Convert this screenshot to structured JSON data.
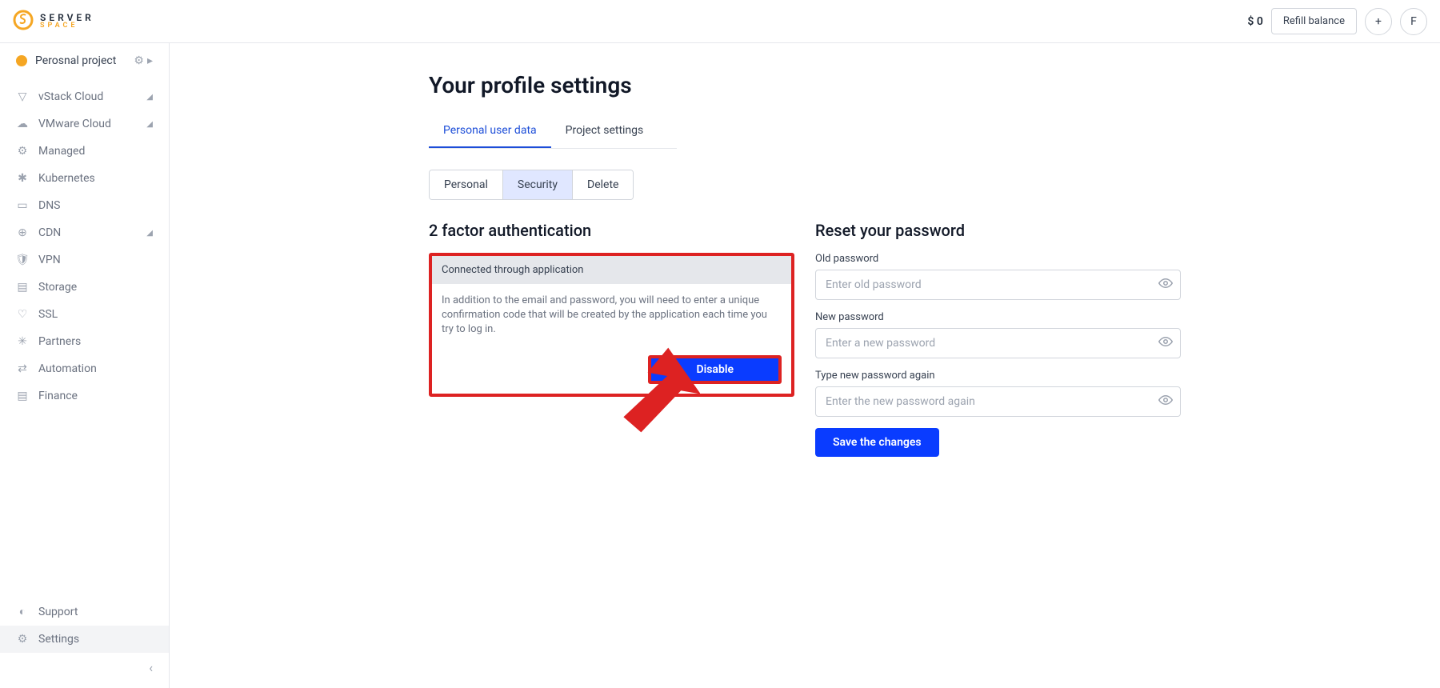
{
  "header": {
    "brand_top": "SERVER",
    "brand_sub": "SPACE",
    "balance": "$ 0",
    "refill_label": "Refill balance",
    "plus_label": "+",
    "avatar_letter": "F"
  },
  "sidebar": {
    "project_name": "Perosnal project",
    "items": [
      {
        "label": "vStack Cloud",
        "icon": "▽",
        "expandable": true
      },
      {
        "label": "VMware Cloud",
        "icon": "☁",
        "expandable": true
      },
      {
        "label": "Managed",
        "icon": "⚙",
        "expandable": false
      },
      {
        "label": "Kubernetes",
        "icon": "✱",
        "expandable": false
      },
      {
        "label": "DNS",
        "icon": "▭",
        "expandable": false
      },
      {
        "label": "CDN",
        "icon": "⊕",
        "expandable": true
      },
      {
        "label": "VPN",
        "icon": "🛡",
        "expandable": false
      },
      {
        "label": "Storage",
        "icon": "▤",
        "expandable": false
      },
      {
        "label": "SSL",
        "icon": "♡",
        "expandable": false
      },
      {
        "label": "Partners",
        "icon": "✳",
        "expandable": false
      },
      {
        "label": "Automation",
        "icon": "⇄",
        "expandable": false
      },
      {
        "label": "Finance",
        "icon": "▤",
        "expandable": false
      }
    ],
    "support_label": "Support",
    "settings_label": "Settings"
  },
  "page": {
    "title": "Your profile settings",
    "tabs": {
      "active": "Personal user data",
      "inactive": "Project settings"
    },
    "subtabs": {
      "personal": "Personal",
      "security": "Security",
      "delete": "Delete"
    },
    "twofa": {
      "heading": "2 factor authentication",
      "connected": "Connected through application",
      "desc": "In addition to the email and password, you will need to enter a unique confirmation code that will be created by the application each time you try to log in.",
      "disable": "Disable"
    },
    "password": {
      "heading": "Reset your password",
      "old_label": "Old password",
      "old_placeholder": "Enter old password",
      "new_label": "New password",
      "new_placeholder": "Enter a new password",
      "again_label": "Type new password again",
      "again_placeholder": "Enter the new password again",
      "save": "Save the changes"
    }
  }
}
